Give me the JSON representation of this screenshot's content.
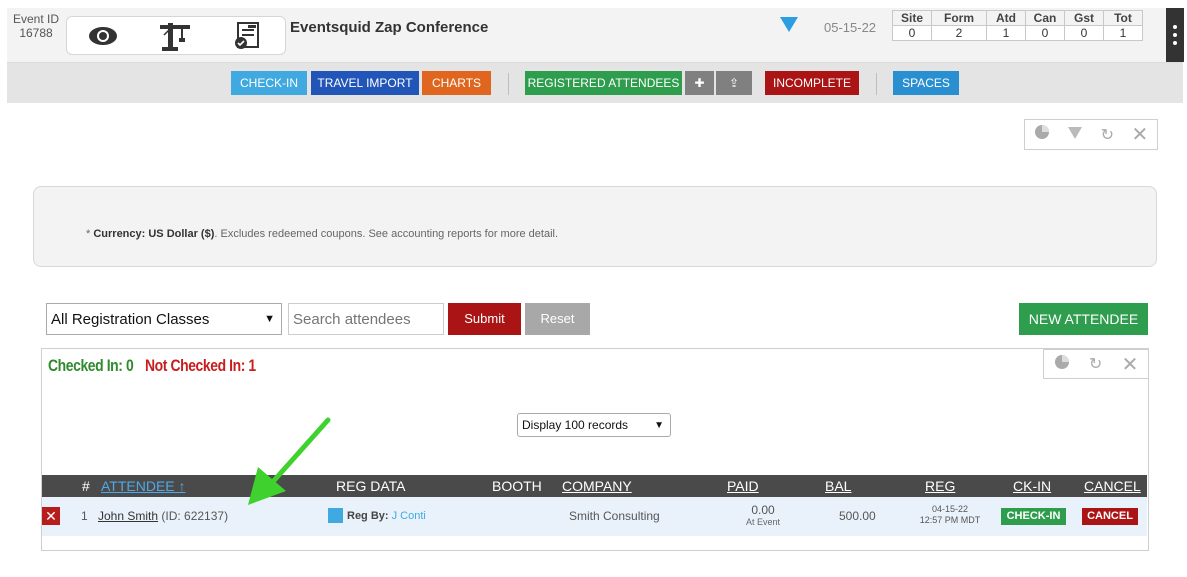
{
  "header": {
    "event_id_label": "Event ID",
    "event_id_value": "16788",
    "icons": [
      "eye-icon",
      "crane-icon",
      "report-icon"
    ],
    "event_title": "Eventsquid Zap Conference",
    "date": "05-15-22",
    "stats": {
      "labels": [
        "Site",
        "Form",
        "Atd",
        "Can",
        "Gst",
        "Tot"
      ],
      "values": [
        "0",
        "2",
        "1",
        "0",
        "0",
        "1"
      ]
    }
  },
  "nav": {
    "check_in": "CHECK-IN",
    "travel_import": "TRAVEL IMPORT",
    "charts": "CHARTS",
    "registered_attendees": "REGISTERED ATTENDEES",
    "add_icon": "✚",
    "upload_icon": "⇪",
    "incomplete": "INCOMPLETE",
    "spaces": "SPACES"
  },
  "colors": {
    "check_in": "#3fa9e0",
    "travel_import": "#2255b8",
    "charts": "#e0661f",
    "registered_attendees": "#2e9e4e",
    "icon_buttons": "#808080",
    "incomplete": "#ab1414",
    "spaces": "#2a8fd1",
    "submit": "#ab1414",
    "reset": "#a8a8a8",
    "new_attendee": "#2e9e4e"
  },
  "notice": {
    "prefix": "* ",
    "bold": "Currency: US Dollar ($)",
    "rest": ". Excludes redeemed coupons. See accounting reports for more detail."
  },
  "filters": {
    "class_select": "All Registration Classes",
    "search_placeholder": "Search attendees",
    "submit": "Submit",
    "reset": "Reset",
    "new_attendee": "NEW ATTENDEE"
  },
  "summary": {
    "checked_in": "Checked In: 0",
    "not_checked_in": "Not Checked In: 1"
  },
  "display_select": "Display 100 records",
  "table": {
    "headers": {
      "num": "#",
      "attendee": "ATTENDEE ↑",
      "reg_data": "REG DATA",
      "booth": "BOOTH",
      "company": "COMPANY",
      "paid": "PAID",
      "bal": "BAL",
      "reg": "REG",
      "ck_in": "CK-IN",
      "cancel": "CANCEL"
    },
    "rows": [
      {
        "num": "1",
        "name": "John Smith",
        "id_text": "(ID: 622137)",
        "reg_by_label": "Reg By:",
        "reg_by_name": "J Conti",
        "company": "Smith Consulting",
        "paid": "0.00",
        "paid_note": "At Event",
        "bal": "500.00",
        "reg_date": "04-15-22",
        "reg_time": "12:57 PM MDT",
        "check_in_btn": "CHECK-IN",
        "cancel_btn": "CANCEL"
      }
    ]
  }
}
